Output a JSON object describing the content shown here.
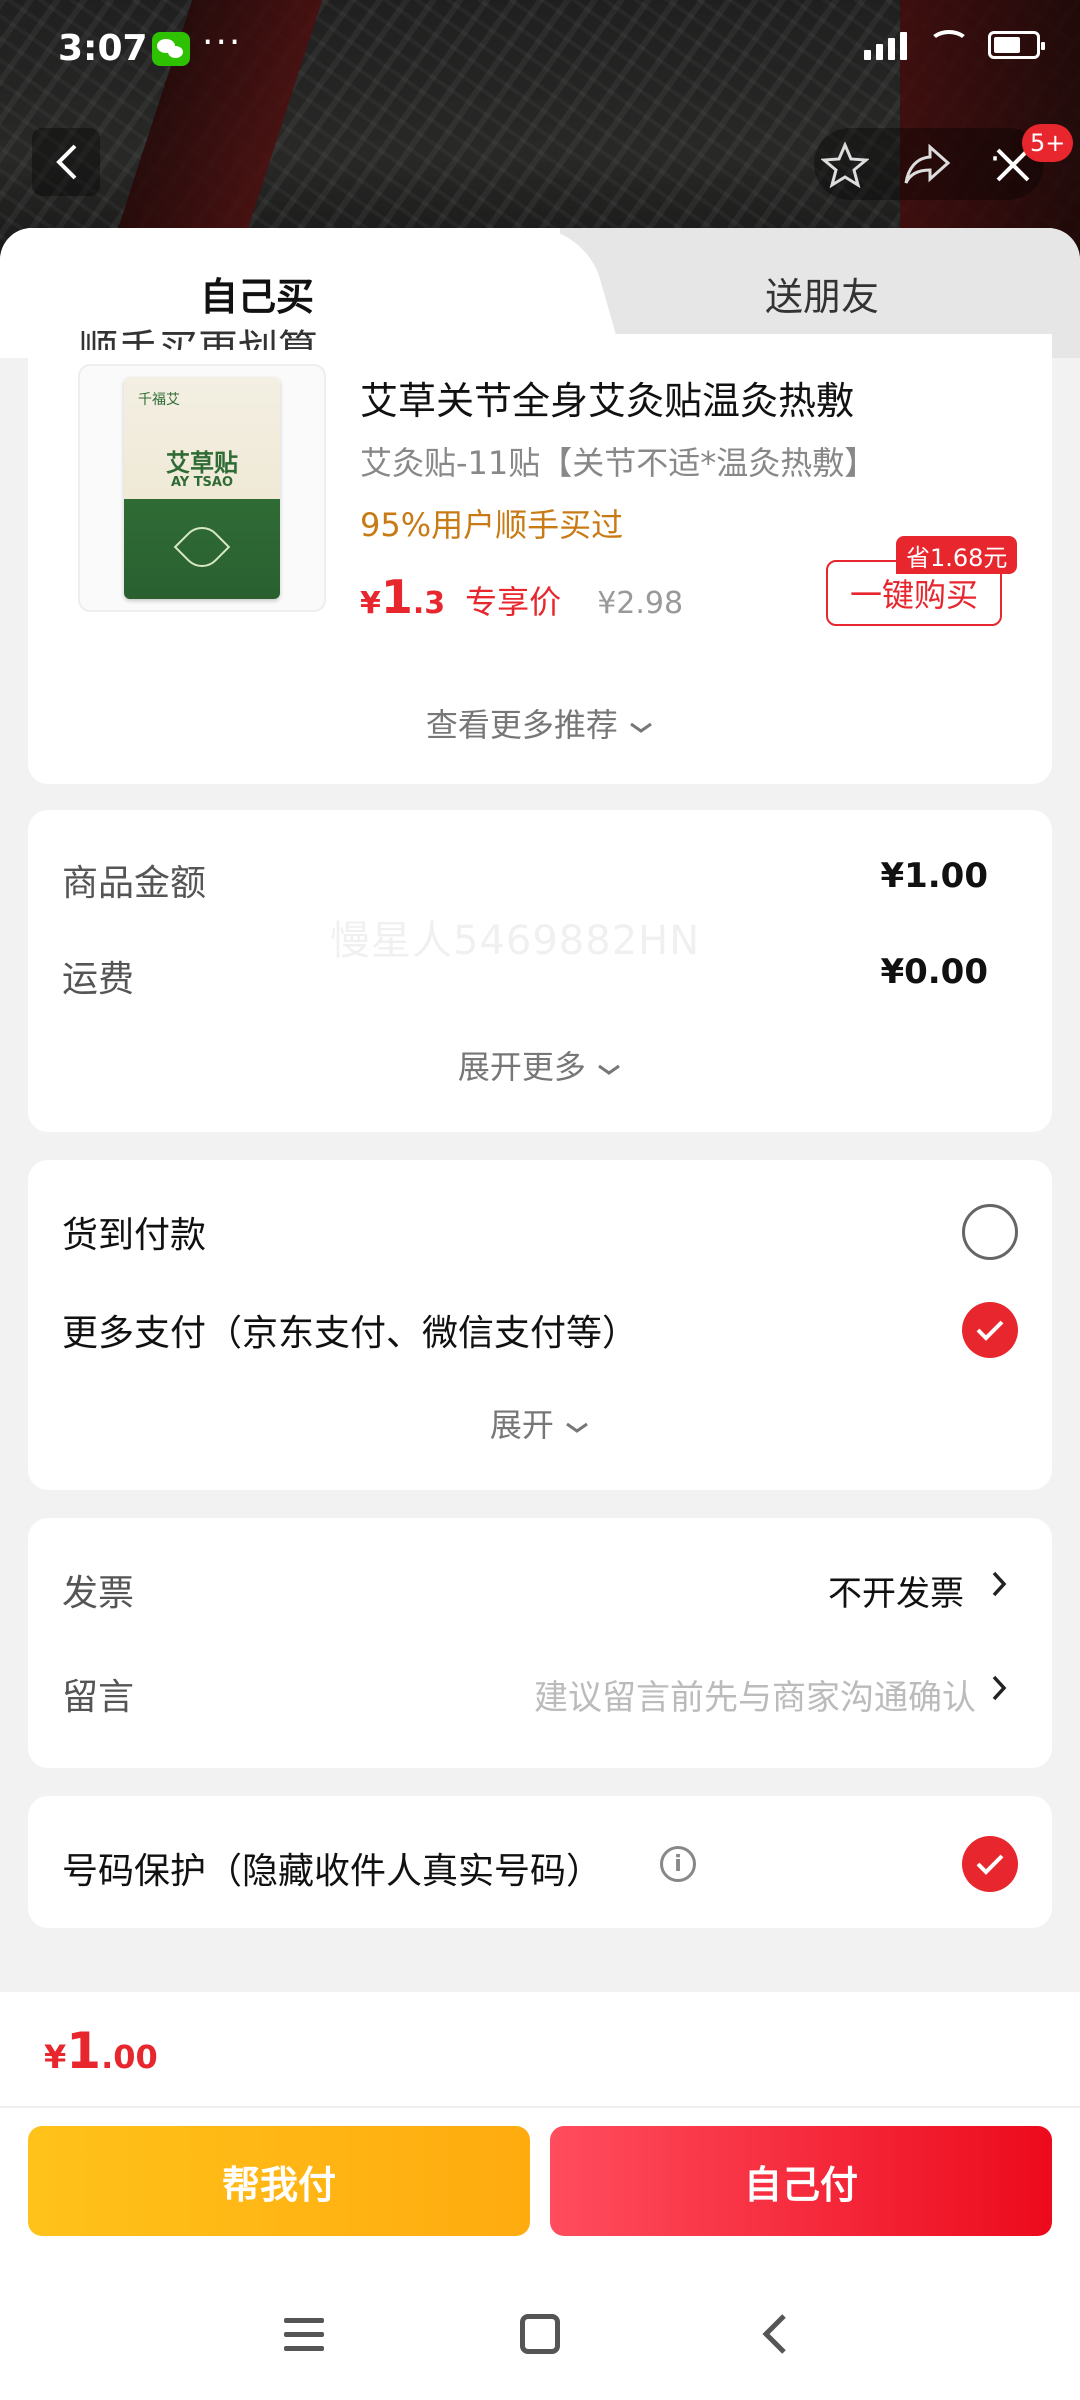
{
  "status_bar": {
    "time": "3:07",
    "dots": "···"
  },
  "nav": {
    "badge": "5+"
  },
  "tabs": {
    "self": "自己买",
    "friend": "送朋友"
  },
  "recommend": {
    "cut_title": "顺手买更划算",
    "product_title": "艾草关节全身艾灸贴温灸热敷",
    "spec": "艾灸贴-11贴【关节不适*温灸热敷】",
    "social_proof": "95%用户顺手买过",
    "price_symbol": "¥",
    "price_int": "1",
    "price_dec": ".3",
    "price_tag": "专享价",
    "original_price": "¥2.98",
    "save_badge": "省1.68元",
    "buy_button": "一键购买",
    "more_link": "查看更多推荐",
    "pack": {
      "brand": "千福艾",
      "title": "艾草贴",
      "subtitle": "AY TSAO"
    }
  },
  "amount": {
    "goods_label": "商品金额",
    "goods_value": "¥1.00",
    "shipping_label": "运费",
    "shipping_value": "¥0.00",
    "expand": "展开更多"
  },
  "watermark": "慢星人5469882HN",
  "payment": {
    "cod_label": "货到付款",
    "more_label": "更多支付（京东支付、微信支付等）",
    "expand": "展开"
  },
  "invoice": {
    "invoice_label": "发票",
    "invoice_value": "不开发票",
    "message_label": "留言",
    "message_placeholder": "建议留言前先与商家沟通确认"
  },
  "protect": {
    "label": "号码保护（隐藏收件人真实号码）"
  },
  "total": {
    "symbol": "¥",
    "int": "1",
    "dec": ".00"
  },
  "actions": {
    "help_pay": "帮我付",
    "self_pay": "自己付"
  },
  "colors": {
    "accent_red": "#e8262d",
    "accent_yellow": "#ffb414",
    "social_orange": "#c87a14"
  }
}
